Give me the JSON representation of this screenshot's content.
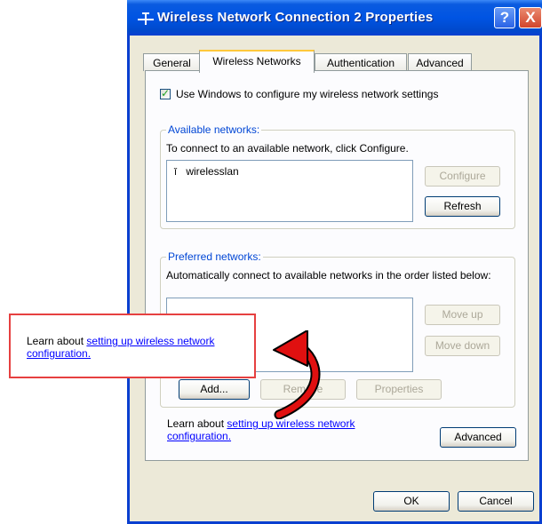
{
  "window": {
    "title": "Wireless Network Connection 2 Properties",
    "help_glyph": "?",
    "close_glyph": "X",
    "title_icon": "network-connection-icon"
  },
  "tabs": [
    {
      "label": "General",
      "active": false
    },
    {
      "label": "Wireless Networks",
      "active": true
    },
    {
      "label": "Authentication",
      "active": false
    },
    {
      "label": "Advanced",
      "active": false
    }
  ],
  "panel": {
    "use_windows_checkbox": {
      "label": "Use Windows to configure my wireless network settings",
      "checked": true
    },
    "available": {
      "legend": "Available networks:",
      "description": "To connect to an available network, click Configure.",
      "items": [
        {
          "icon": "antenna-icon",
          "name": "wirelesslan"
        }
      ],
      "configure_label": "Configure",
      "refresh_label": "Refresh"
    },
    "preferred": {
      "legend": "Preferred networks:",
      "description": "Automatically connect to available networks in the order listed below:",
      "move_up_label": "Move up",
      "move_down_label": "Move down",
      "add_label": "Add...",
      "remove_label": "Remove",
      "properties_label": "Properties"
    },
    "learn": {
      "prefix": "Learn about ",
      "link": "setting up wireless network configuration.",
      "link_line1": "setting up wireless network",
      "link_line2": "configuration."
    },
    "advanced_label": "Advanced"
  },
  "footer": {
    "ok_label": "OK",
    "cancel_label": "Cancel"
  },
  "callout": {
    "prefix": "Learn about ",
    "link_line1": "setting up wireless network",
    "link_line2": "configuration.",
    "border_color": "#e64040",
    "arrow_color": "#e01010"
  }
}
